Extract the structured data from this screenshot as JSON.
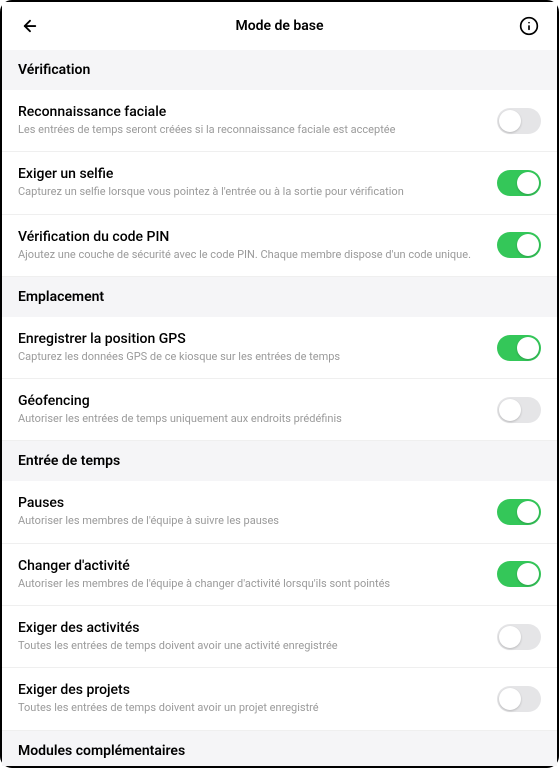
{
  "header": {
    "title": "Mode de base"
  },
  "sections": {
    "verification": {
      "title": "Vérification",
      "items": {
        "facial": {
          "title": "Reconnaissance faciale",
          "desc": "Les entrées de temps seront créées si la reconnaissance faciale est acceptée",
          "on": false
        },
        "selfie": {
          "title": "Exiger un selfie",
          "desc": "Capturez un selfie lorsque vous pointez à l'entrée ou à la sortie pour vérification",
          "on": true
        },
        "pin": {
          "title": "Vérification du code PIN",
          "desc": "Ajoutez une couche de sécurité avec le code PIN. Chaque membre dispose d'un code unique.",
          "on": true
        }
      }
    },
    "location": {
      "title": "Emplacement",
      "items": {
        "gps": {
          "title": "Enregistrer la position GPS",
          "desc": "Capturez les données GPS de ce kiosque sur les entrées de temps",
          "on": true
        },
        "geofencing": {
          "title": "Géofencing",
          "desc": "Autoriser les entrées de temps uniquement aux endroits prédéfinis",
          "on": false
        }
      }
    },
    "time": {
      "title": "Entrée de temps",
      "items": {
        "breaks": {
          "title": "Pauses",
          "desc": "Autoriser les membres de l'équipe à suivre les pauses",
          "on": true
        },
        "change": {
          "title": "Changer d'activité",
          "desc": "Autoriser les membres de l'équipe à changer d'activité lorsqu'ils sont pointés",
          "on": true
        },
        "activities": {
          "title": "Exiger des activités",
          "desc": "Toutes les entrées de temps doivent avoir une activité enregistrée",
          "on": false
        },
        "projects": {
          "title": "Exiger des projets",
          "desc": "Toutes les entrées de temps doivent avoir un projet enregistré",
          "on": false
        }
      }
    },
    "modules": {
      "title": "Modules complémentaires"
    }
  }
}
